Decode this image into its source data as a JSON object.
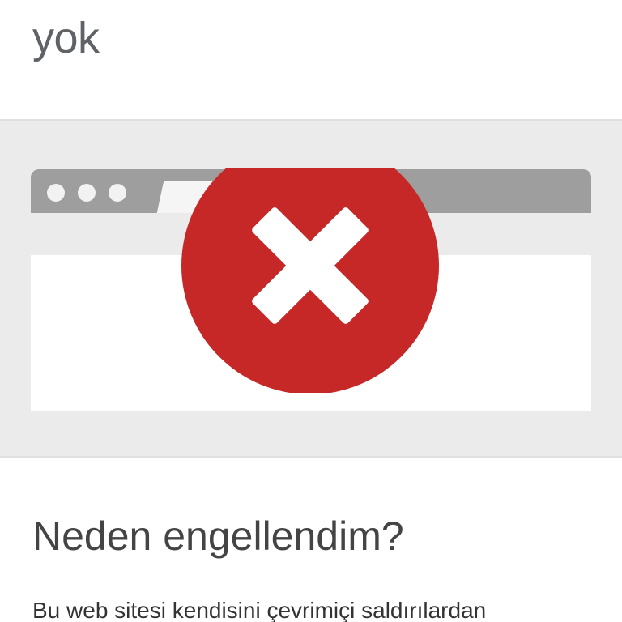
{
  "page": {
    "title_line_partial": "yok",
    "section_heading": "Neden engellendim?",
    "body_text": "Bu web sitesi kendisini çevrimiçi saldırılardan"
  },
  "illustration": {
    "icon": "error-x-icon",
    "band_color": "#ebebeb",
    "toolbar_color": "#9e9e9e",
    "error_color": "#c62828"
  }
}
